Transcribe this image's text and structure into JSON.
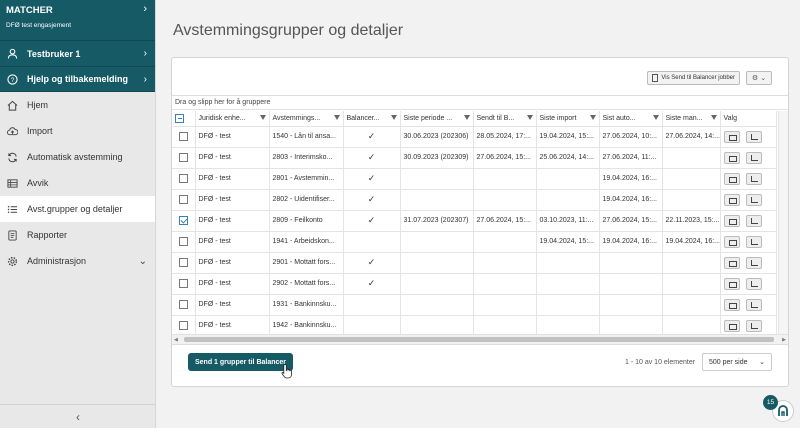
{
  "sidebar": {
    "app_name": "MATCHER",
    "engagement": "DFØ test engasjement",
    "user": "Testbruker 1",
    "help": "Hjelp og tilbakemelding",
    "items": [
      {
        "label": "Hjem",
        "icon": "home-icon"
      },
      {
        "label": "Import",
        "icon": "cloud-upload-icon"
      },
      {
        "label": "Automatisk avstemming",
        "icon": "sync-icon"
      },
      {
        "label": "Avvik",
        "icon": "table-icon"
      },
      {
        "label": "Avst.grupper og detaljer",
        "icon": "list-icon",
        "active": true
      },
      {
        "label": "Rapporter",
        "icon": "report-icon"
      },
      {
        "label": "Administrasjon",
        "icon": "gear-icon"
      }
    ]
  },
  "page": {
    "title": "Avstemmingsgrupper og detaljer"
  },
  "toolbar": {
    "jobs_button": "Vis Send til Balancer jobber"
  },
  "grid": {
    "group_hint": "Dra og slipp her for å gruppere",
    "columns": [
      "Juridisk enhe...",
      "Avstemmings...",
      "Balancer...",
      "Siste periode ...",
      "Sendt til B...",
      "Siste import",
      "Sist auto...",
      "Siste man...",
      "Valg"
    ],
    "rows": [
      {
        "checked": false,
        "entity": "DFØ - test",
        "group": "1540 - Lån til ansa...",
        "balancer": true,
        "period": "30.06.2023 (202306)",
        "sent": "28.05.2024, 17:...",
        "import": "19.04.2024, 15:...",
        "auto": "27.06.2024, 10:...",
        "manual": "27.06.2024, 14:..."
      },
      {
        "checked": false,
        "entity": "DFØ - test",
        "group": "2803 - Interimsko...",
        "balancer": true,
        "period": "30.09.2023 (202309)",
        "sent": "27.06.2024, 15:...",
        "import": "25.06.2024, 14:...",
        "auto": "27.06.2024, 11:...",
        "manual": ""
      },
      {
        "checked": false,
        "entity": "DFØ - test",
        "group": "2801 - Avstemmin...",
        "balancer": true,
        "period": "",
        "sent": "",
        "import": "",
        "auto": "19.04.2024, 16:...",
        "manual": ""
      },
      {
        "checked": false,
        "entity": "DFØ - test",
        "group": "2802 - Uidentifiser...",
        "balancer": true,
        "period": "",
        "sent": "",
        "import": "",
        "auto": "19.04.2024, 16:...",
        "manual": ""
      },
      {
        "checked": true,
        "entity": "DFØ - test",
        "group": "2809 - Feilkonto",
        "balancer": true,
        "period": "31.07.2023 (202307)",
        "sent": "27.06.2024, 15:...",
        "import": "03.10.2023, 11:...",
        "auto": "27.06.2024, 15:...",
        "manual": "22.11.2023, 15:..."
      },
      {
        "checked": false,
        "entity": "DFØ - test",
        "group": "1941 - Arbeidskon...",
        "balancer": false,
        "period": "",
        "sent": "",
        "import": "19.04.2024, 15:...",
        "auto": "19.04.2024, 16:...",
        "manual": "19.04.2024, 16:..."
      },
      {
        "checked": false,
        "entity": "DFØ - test",
        "group": "2901 - Mottatt fors...",
        "balancer": true,
        "period": "",
        "sent": "",
        "import": "",
        "auto": "",
        "manual": ""
      },
      {
        "checked": false,
        "entity": "DFØ - test",
        "group": "2902 - Mottatt fors...",
        "balancer": true,
        "period": "",
        "sent": "",
        "import": "",
        "auto": "",
        "manual": ""
      },
      {
        "checked": false,
        "entity": "DFØ - test",
        "group": "1931 - Bankinnsku...",
        "balancer": false,
        "period": "",
        "sent": "",
        "import": "",
        "auto": "",
        "manual": ""
      },
      {
        "checked": false,
        "entity": "DFØ - test",
        "group": "1942 - Bankinnsku...",
        "balancer": false,
        "period": "",
        "sent": "",
        "import": "",
        "auto": "",
        "manual": ""
      }
    ]
  },
  "footer": {
    "send_button": "Send 1 grupper til Balancer",
    "pager_info": "1 - 10 av 10 elementer",
    "per_page": "500 per side"
  },
  "notification_count": "15",
  "colors": {
    "brand": "#165a66",
    "selection": "#3a7fb5"
  }
}
